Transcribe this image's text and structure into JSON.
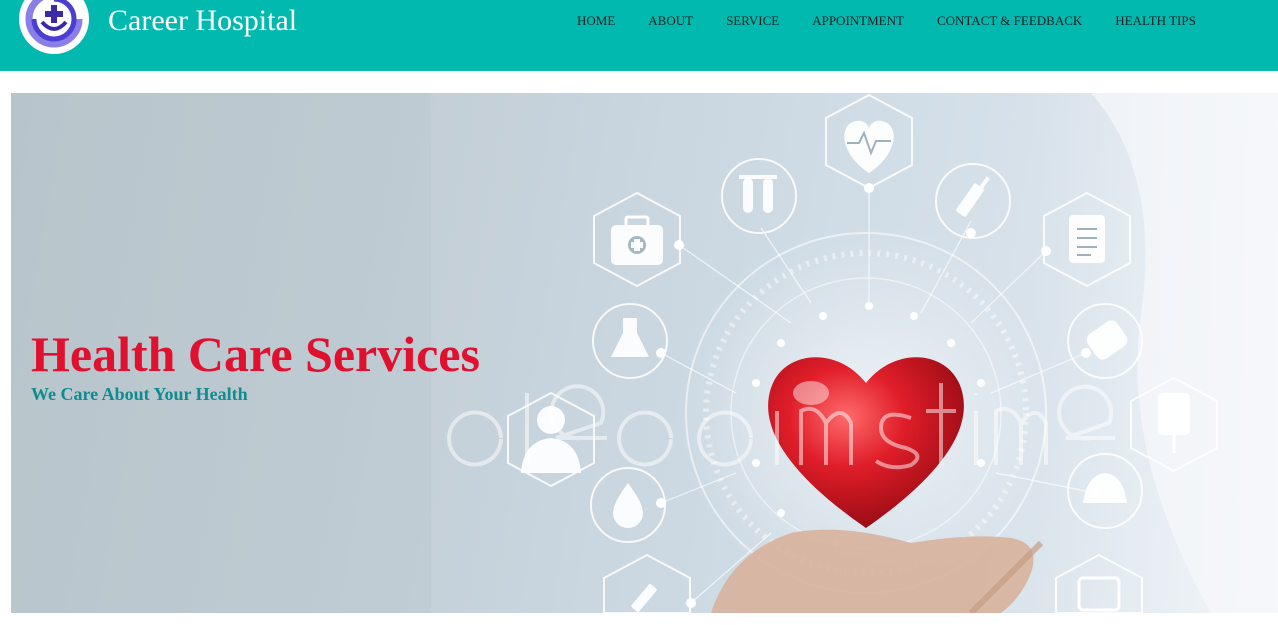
{
  "header": {
    "brand": "Career Hospital",
    "nav": [
      "HOME",
      "ABOUT",
      "SERVICE",
      "APPOINTMENT",
      "CONTACT & FEEDBACK",
      "HEALTH TIPS"
    ]
  },
  "hero": {
    "title": "Health Care Services",
    "subtitle": "We Care About Your Health",
    "icons": [
      "heart-rate-icon",
      "first-aid-kit-icon",
      "test-tubes-icon",
      "syringe-icon",
      "clipboard-icon",
      "flask-icon",
      "pills-icon",
      "doctor-icon",
      "blood-drop-icon",
      "nurse-cap-icon",
      "iv-bag-icon",
      "needle-icon",
      "ecg-monitor-icon"
    ]
  },
  "colors": {
    "header_bg": "#02b9b0",
    "brand_text": "#ffffff",
    "nav_text": "#1f1f1f",
    "hero_title": "#e0102e",
    "hero_subtitle": "#0e8c8f",
    "heart": "#d5141f"
  }
}
